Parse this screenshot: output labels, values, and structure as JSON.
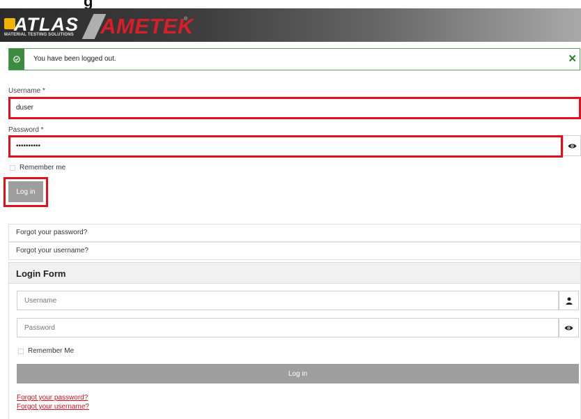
{
  "page": {
    "cut_title": "g"
  },
  "header": {
    "logo_atlas": "ATLAS",
    "logo_atlas_sub": "MATERIAL TESTING SOLUTIONS",
    "logo_ametek": "AMETEK"
  },
  "alert": {
    "message": "You have been logged out.",
    "close_glyph": "✕",
    "status_color": "#3d8b41"
  },
  "main_form": {
    "username_label": "Username *",
    "username_value": "duser",
    "password_label": "Password *",
    "password_value": "••••••••••",
    "remember_label": "Remember me",
    "submit_label": "Log in"
  },
  "links": {
    "forgot_password": "Forgot your password?",
    "forgot_username": "Forgot your username?"
  },
  "login_module": {
    "title": "Login Form",
    "username_placeholder": "Username",
    "password_placeholder": "Password",
    "remember_label": "Remember Me",
    "submit_label": "Log in",
    "forgot_password": "Forgot your password?",
    "forgot_username": "Forgot your username?"
  },
  "colors": {
    "highlight": "#e3101b",
    "button_grey": "#9e9e9e",
    "link_red": "#d6101d"
  },
  "icons": {
    "alert": "check-circle-icon",
    "close": "close-icon",
    "eye": "eye-icon",
    "user": "user-icon"
  }
}
